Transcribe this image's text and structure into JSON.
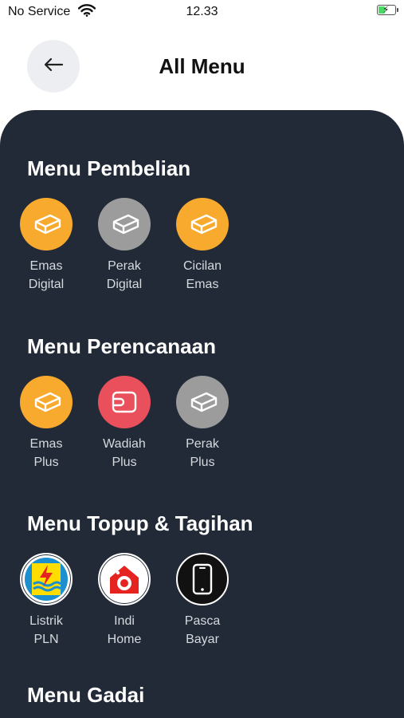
{
  "status_bar": {
    "carrier": "No Service",
    "time": "12.33",
    "battery_level": 0.4,
    "icons": [
      "wifi-icon",
      "battery-charging-icon"
    ]
  },
  "header": {
    "title": "All Menu",
    "back_icon": "arrow-left-icon"
  },
  "colors": {
    "panel": "#222a37",
    "gold": "#f7aa2d",
    "silver": "#9c9c9c",
    "red": "#e9505c"
  },
  "sections": [
    {
      "title": "Menu Pembelian",
      "items": [
        {
          "label": "Emas\nDigital",
          "icon": "gold-bar-icon"
        },
        {
          "label": "Perak\nDigital",
          "icon": "silver-bar-icon"
        },
        {
          "label": "Cicilan\nEmas",
          "icon": "gold-bar-icon"
        }
      ]
    },
    {
      "title": "Menu Perencanaan",
      "items": [
        {
          "label": "Emas\nPlus",
          "icon": "gold-bar-icon"
        },
        {
          "label": "Wadiah\nPlus",
          "icon": "wallet-icon"
        },
        {
          "label": "Perak\nPlus",
          "icon": "silver-bar-icon"
        }
      ]
    },
    {
      "title": "Menu Topup & Tagihan",
      "items": [
        {
          "label": "Listrik\nPLN",
          "icon": "pln-logo-icon"
        },
        {
          "label": "Indi\nHome",
          "icon": "indihome-logo-icon"
        },
        {
          "label": "Pasca\nBayar",
          "icon": "smartphone-icon"
        }
      ]
    },
    {
      "title": "Menu Gadai",
      "items": []
    }
  ]
}
